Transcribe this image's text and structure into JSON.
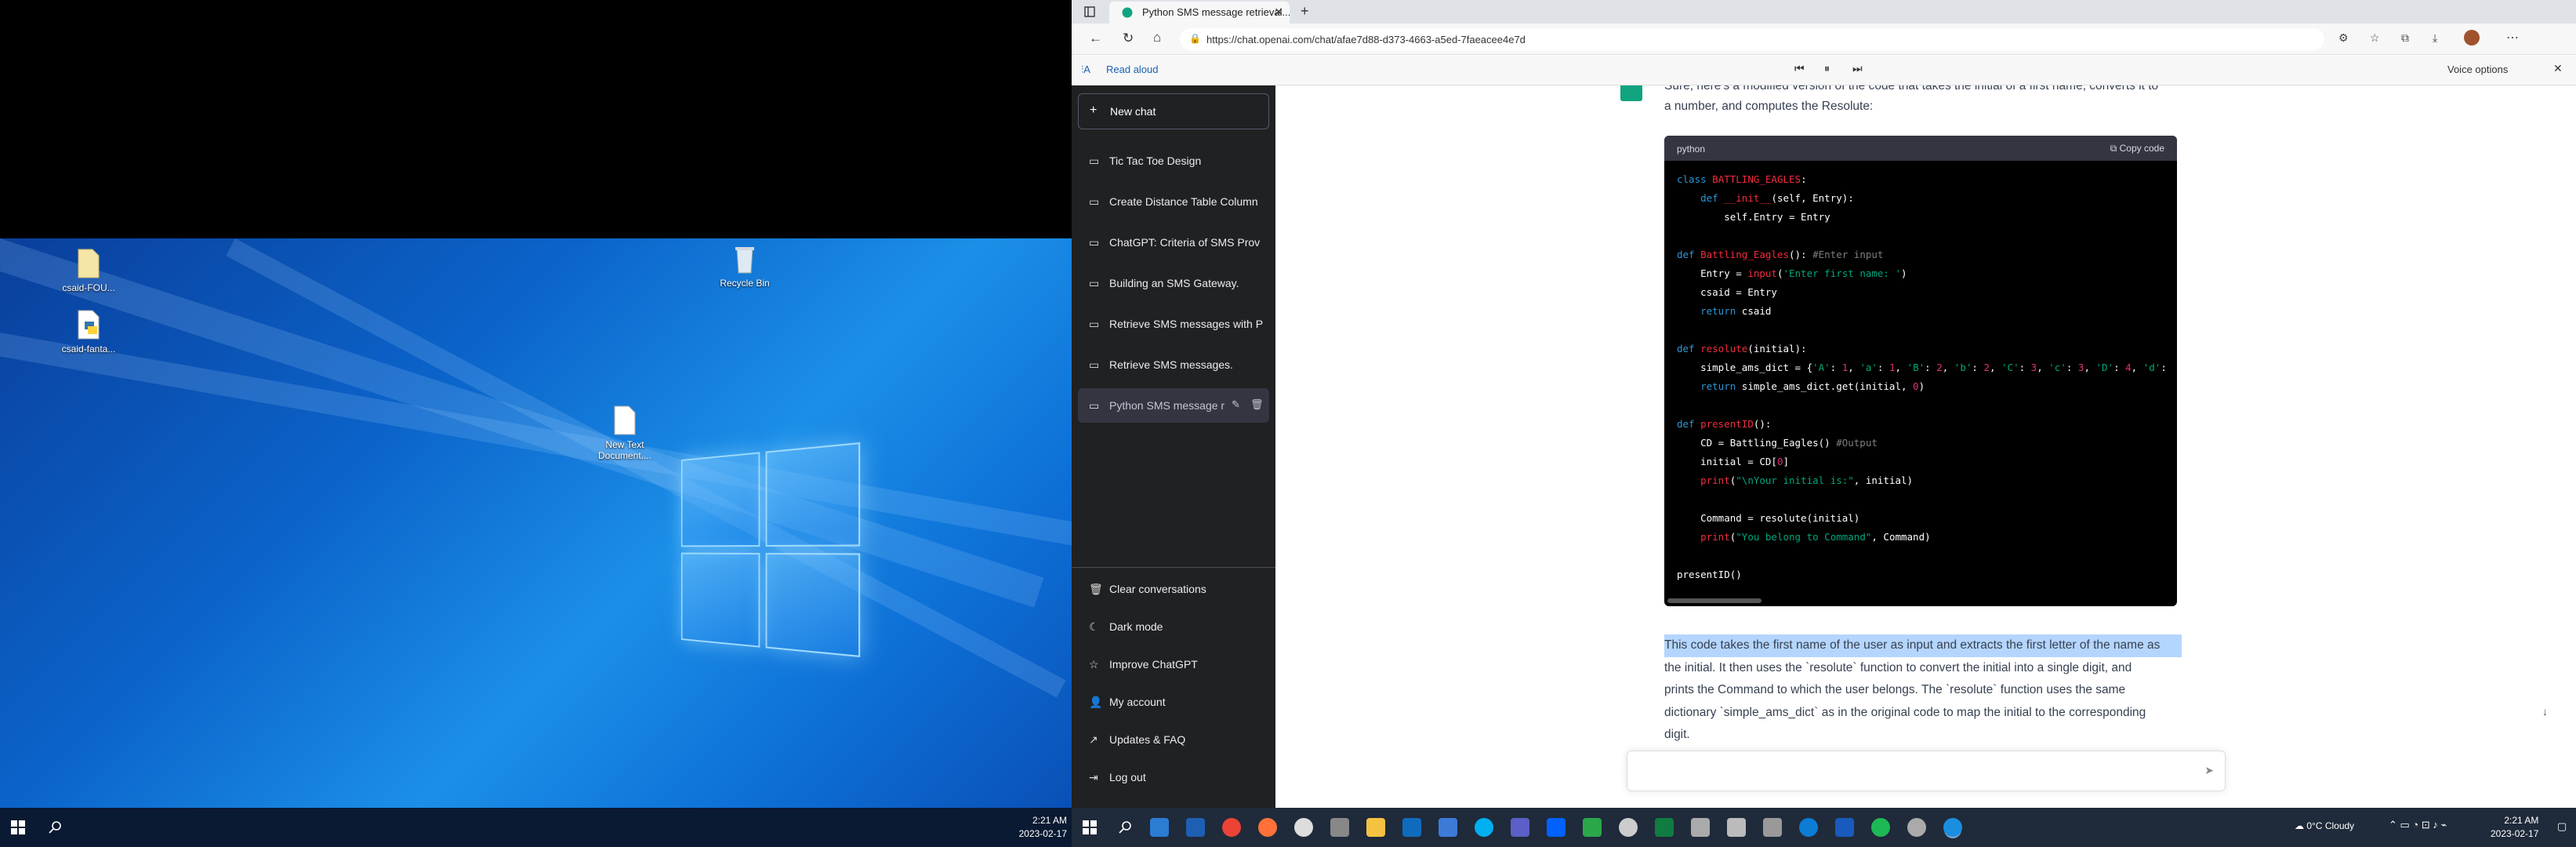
{
  "left_desktop": {
    "icons": [
      {
        "label": "csaid-FOU...",
        "icon": "file-icon"
      },
      {
        "label": "csaid-fanta...",
        "icon": "python-file-icon"
      },
      {
        "label": "Recycle Bin",
        "icon": "recycle-bin-icon"
      },
      {
        "label": "New Text Document....",
        "icon": "text-file-icon"
      }
    ],
    "clock_time": "2:21 AM",
    "clock_date": "2023-02-17"
  },
  "browser": {
    "tab_title": "Python SMS message retrieval...",
    "url": "https://chat.openai.com/chat/afae7d88-d373-4663-a5ed-7faeacee4e7d",
    "read_aloud": "Read aloud",
    "voice_options": "Voice options"
  },
  "sidebar": {
    "new_chat": "New chat",
    "conversations": [
      "Tic Tac Toe Design",
      "Create Distance Table Column",
      "ChatGPT: Criteria of SMS Prov",
      "Building an SMS Gateway.",
      "Retrieve SMS messages with P",
      "Retrieve SMS messages.",
      "Python SMS message r"
    ],
    "bottom": [
      {
        "label": "Clear conversations",
        "icon": "trash-icon"
      },
      {
        "label": "Dark mode",
        "icon": "moon-icon"
      },
      {
        "label": "Improve ChatGPT",
        "icon": "star-icon"
      },
      {
        "label": "My account",
        "icon": "user-icon"
      },
      {
        "label": "Updates & FAQ",
        "icon": "external-link-icon"
      },
      {
        "label": "Log out",
        "icon": "logout-icon"
      }
    ]
  },
  "chat": {
    "intro_line1": "Sure, here's a modified version of the code that takes the initial of a first name, converts it to",
    "intro_line2": "a number, and computes the Resolute:",
    "code_lang": "python",
    "copy_code": "Copy code",
    "para_lines": [
      "This code takes the first name of the user as input and extracts the first letter of the name as",
      "the initial. It then uses the `resolute` function to convert the initial into a single digit, and",
      "prints the Command to which the user belongs. The `resolute` function uses the same",
      "dictionary `simple_ams_dict` as in the original code to map the initial to the corresponding",
      "digit."
    ]
  },
  "right_taskbar": {
    "weather": "0°C  Cloudy",
    "clock_time": "2:21 AM",
    "clock_date": "2023-02-17"
  }
}
